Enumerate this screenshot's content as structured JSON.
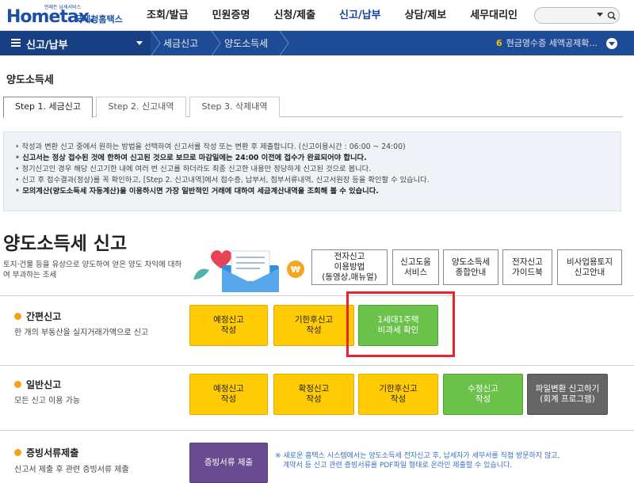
{
  "header": {
    "logo_small": "언제든 납세서비스",
    "logo_text": "Hometax.",
    "logo_kor": "국세청홈택스",
    "menu": [
      "조회/발급",
      "민원증명",
      "신청/제출",
      "신고/납부",
      "상담/제보",
      "세무대리인"
    ],
    "active_menu": "신고/납부"
  },
  "navbar": {
    "menu_label": "신고/납부",
    "breadcrumb": [
      "세금신고",
      "양도소득세"
    ],
    "right_num": "6",
    "right_text": "현금영수증 세액공제확..."
  },
  "page": {
    "heading": "양도소득세",
    "tabs": [
      "Step 1. 세금신고",
      "Step 2. 신고내역",
      "Step 3. 삭제내역"
    ],
    "notices": [
      "작성과 변환 신고 중에서 원하는 방법을 선택하여 신고서를 작성 또는 변환 후 제출합니다. (신고이용시간 : 06:00 ~ 24:00)",
      "신고서는 정상 접수된 것에 한하여 신고된 것으로 보므로 마감일에는 24:00 이전에 접수가 완료되어야 합니다.",
      "정기신고인 경우 해당 신고기한 내에 여러 번 신고를 하더라도 최종 신고한 내용만 정당하게 신고된 것으로 봅니다.",
      "신고 후 접수결과(정상)를 꼭 확인하고, [Step 2. 신고내역]에서 접수증, 납부서, 첨부서류내역, 신고서원장 등을 확인할 수 있습니다.",
      "모의계산(양도소득세 자동계산)을 이용하시면 가장 일반적인 거래에 대하여 세금계산내역을 조회해 볼 수 있습니다."
    ],
    "section_title": "양도소득세 신고",
    "section_desc": "토지·건물 등을 유상으로 양도하여 얻은 양도 차익에 대하여 부과하는 조세",
    "help_buttons": [
      [
        "전자신고",
        "이용방법",
        "(동영상,매뉴얼)"
      ],
      [
        "신고도움",
        "서비스"
      ],
      [
        "양도소득세",
        "종합안내"
      ],
      [
        "전자신고",
        "가이드북"
      ],
      [
        "비사업용토지",
        "신고안내"
      ]
    ]
  },
  "groups": {
    "simple": {
      "title": "간편신고",
      "desc": "한 개의 부동산을 실지거래가액으로 신고",
      "buttons": [
        [
          "예정신고",
          "작성"
        ],
        [
          "기한후신고",
          "작성"
        ],
        [
          "1세대1주택",
          "비과세 확인"
        ]
      ]
    },
    "general": {
      "title": "일반신고",
      "desc": "모든 신고 이용 가능",
      "buttons": [
        [
          "예정신고",
          "작성"
        ],
        [
          "확정신고",
          "작성"
        ],
        [
          "기한후신고",
          "작성"
        ],
        [
          "수정신고",
          "작성"
        ],
        [
          "파일변환 신고하기",
          "(회계 프로그램)"
        ]
      ]
    },
    "proof": {
      "title": "증빙서류제출",
      "desc": "신고서 제출 후 관련 증빙서류 제출",
      "button": "증빙서류 제출",
      "note": [
        "※ 새로운 홈택스 시스템에서는 양도소득세 전자신고 후, 납세자가 세무서를 직접 방문하지 않고,",
        "계약서 등 신고 관련 증빙서류를 PDF파일 형태로 온라인 제출할 수 있습니다."
      ]
    }
  },
  "colors": {
    "header_blue": "#1d4b96",
    "yellow": "#ffcb05",
    "green": "#6ac24b",
    "gray": "#666666",
    "purple": "#6b4b8f",
    "highlight": "#e8242a"
  }
}
